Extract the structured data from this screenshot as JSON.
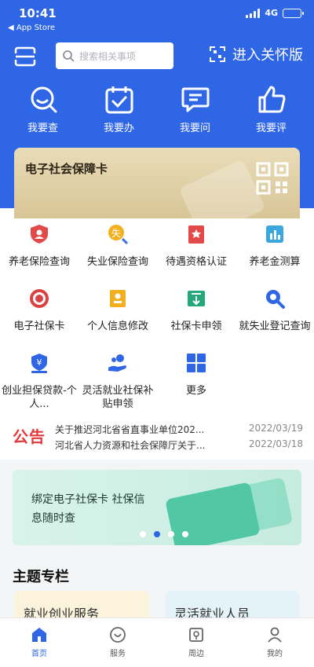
{
  "status": {
    "time": "10:41",
    "back_label": "◀ App Store",
    "network": "4G",
    "battery_level": 0.75
  },
  "header": {
    "search_placeholder": "搜索相关事项",
    "care_label": "进入关怀版"
  },
  "quick_actions": [
    {
      "label": "我要查",
      "icon": "magnify-chat-icon"
    },
    {
      "label": "我要办",
      "icon": "calendar-check-icon"
    },
    {
      "label": "我要问",
      "icon": "chat-icon"
    },
    {
      "label": "我要评",
      "icon": "thumb-up-icon"
    }
  ],
  "card": {
    "title": "电子社会保障卡"
  },
  "services": [
    {
      "label": "养老保险查询",
      "icon": "pension-icon",
      "color": "#e24a4a"
    },
    {
      "label": "失业保险查询",
      "icon": "unemployment-icon",
      "color": "#f2b01e"
    },
    {
      "label": "待遇资格认证",
      "icon": "certification-icon",
      "color": "#e24a4a"
    },
    {
      "label": "养老金测算",
      "icon": "chart-icon",
      "color": "#3aa7de"
    },
    {
      "label": "电子社保卡",
      "icon": "badge-icon",
      "color": "#d94343"
    },
    {
      "label": "个人信息修改",
      "icon": "profile-card-icon",
      "color": "#f2b01e"
    },
    {
      "label": "社保卡申领",
      "icon": "download-card-icon",
      "color": "#25a77c"
    },
    {
      "label": "就失业登记查询",
      "icon": "search-icon",
      "color": "#2f66e6"
    },
    {
      "label": "创业担保贷款-个人...",
      "icon": "loan-icon",
      "color": "#2f66e6"
    },
    {
      "label": "灵活就业社保补贴申领",
      "icon": "hand-coin-icon",
      "color": "#2f66e6"
    },
    {
      "label": "更多",
      "icon": "grid-icon",
      "color": "#2f66e6"
    }
  ],
  "notices": {
    "tag": "公告",
    "items": [
      {
        "title": "关于推迟河北省省直事业单位202...",
        "date": "2022/03/19"
      },
      {
        "title": "河北省人力资源和社会保障厅关于...",
        "date": "2022/03/18"
      }
    ]
  },
  "banner": {
    "text": "绑定电子社保卡 社保信息随时查",
    "active_dot": 1
  },
  "topics": {
    "title": "主题专栏",
    "items": [
      "就业创业服务",
      "灵活就业人员"
    ]
  },
  "tabs": [
    {
      "label": "首页",
      "icon": "home-icon",
      "active": true
    },
    {
      "label": "服务",
      "icon": "service-icon",
      "active": false
    },
    {
      "label": "周边",
      "icon": "nearby-icon",
      "active": false
    },
    {
      "label": "我的",
      "icon": "profile-icon",
      "active": false
    }
  ],
  "colors": {
    "brand": "#2f66e6",
    "notice_red": "#e4393c"
  }
}
